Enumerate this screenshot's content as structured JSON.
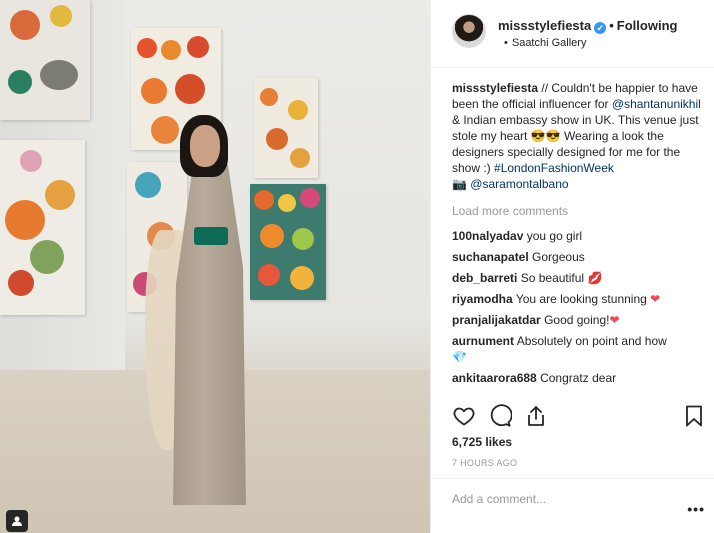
{
  "post": {
    "username": "missstylefiesta",
    "follow_label": "Following",
    "location": "Saatchi Gallery",
    "caption_user": "missstylefiesta",
    "caption_parts": [
      "// Couldn't be happier to have been the official influencer for ",
      "@shantanunikhil",
      " & Indian embassy show in UK. This venue just stole my heart",
      " Wearing a look the designers specially designed for me for the show :) ",
      "#LondonFashionWeek",
      "@saramontalbano"
    ],
    "load_more": "Load more comments",
    "comments": [
      {
        "user": "100nalyadav",
        "text": "you go girl",
        "emoji": ""
      },
      {
        "user": "suchanapatel",
        "text": "Gorgeous",
        "emoji": ""
      },
      {
        "user": "deb_barreti",
        "text": "So beautiful",
        "emoji": "lips"
      },
      {
        "user": "riyamodha",
        "text": "You are looking stunning",
        "emoji": "heart"
      },
      {
        "user": "pranjalijakatdar",
        "text": "Good going!",
        "emoji": "heart"
      },
      {
        "user": "aurnument",
        "text": "Absolutely on point and how",
        "emoji": "gem"
      },
      {
        "user": "ankitaarora688",
        "text": "Congratz dear",
        "emoji": ""
      }
    ],
    "likes": "6,725 likes",
    "timestamp": "7 HOURS AGO",
    "add_comment_placeholder": "Add a comment...",
    "more_label": "•••"
  },
  "icons": {
    "like": "heart-outline-icon",
    "comment": "speech-bubble-icon",
    "share": "share-icon",
    "save": "bookmark-icon",
    "verified": "verified-badge-icon",
    "tagged": "tagged-user-icon"
  },
  "colors": {
    "link": "#003569",
    "verified": "#3897f0",
    "muted": "#999999",
    "text": "#262626"
  }
}
